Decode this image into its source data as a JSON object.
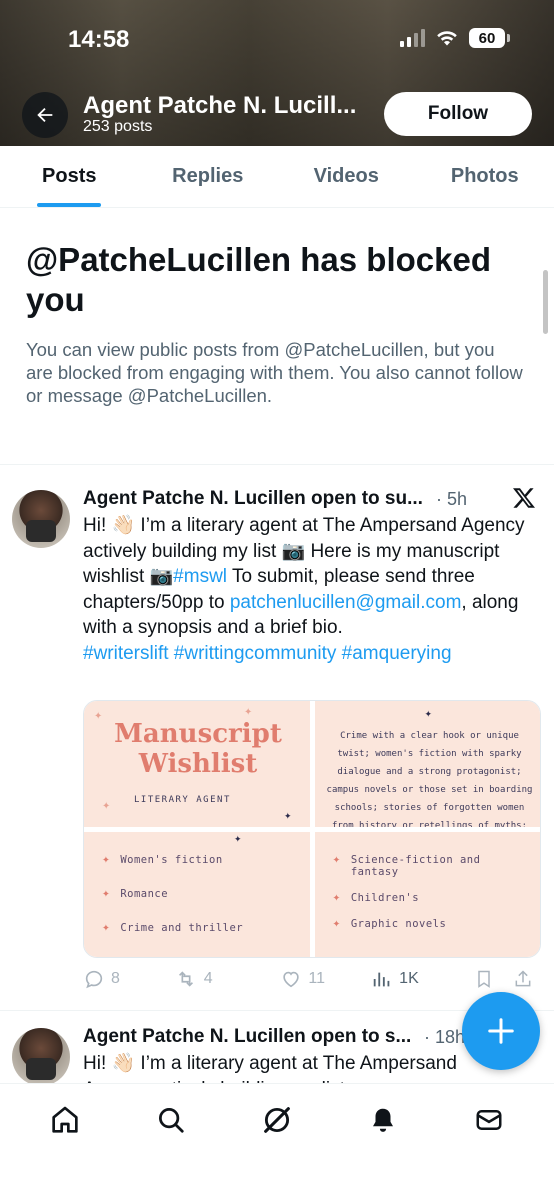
{
  "status_bar": {
    "time": "14:58",
    "battery": "60"
  },
  "header": {
    "title": "Agent Patche N. Lucill...",
    "posts_count": "253 posts",
    "follow_label": "Follow"
  },
  "tabs": [
    {
      "label": "Posts",
      "active": true
    },
    {
      "label": "Replies",
      "active": false
    },
    {
      "label": "Videos",
      "active": false
    },
    {
      "label": "Photos",
      "active": false
    }
  ],
  "blocked": {
    "title": "@PatcheLucillen has blocked you",
    "message": "You can view public posts from @PatcheLucillen, but you are blocked from engaging with them. You also cannot follow or message @PatcheLucillen."
  },
  "post1": {
    "author": "Agent Patche N. Lucillen open to su...",
    "time": "· 5h",
    "text_a": "Hi! 👋🏻 I’m a literary agent at The Ampersand Agency actively building my list 📷 Here is my manuscript wishlist 📷",
    "hashtag_mswl": "#mswl",
    "text_b": " To submit, please send three chapters/50pp to ",
    "email": "patchenlucillen@gmail.com",
    "text_c": ", along with a synopsis and a brief bio.",
    "hashtags": "#writerslift #writtingcommunity #amquerying",
    "media": {
      "title_line1": "Manuscript",
      "title_line2": "Wishlist",
      "subtitle": "LITERARY AGENT",
      "description": "Crime with a clear hook or unique twist; women's fiction with sparky dialogue and a strong protagonist; campus novels or those set in boarding schools; stories of forgotten women from history or retellings of myths:",
      "genres_left": [
        "Women's fiction",
        "Romance",
        "Crime and thriller"
      ],
      "genres_right": [
        "Science-fiction and fantasy",
        "Children's",
        "Graphic novels"
      ]
    },
    "stats": {
      "replies": "8",
      "reposts": "4",
      "likes": "11",
      "views": "1K"
    }
  },
  "post2": {
    "author": "Agent Patche N. Lucillen open to s...",
    "time": "· 18h",
    "text": "Hi! 👋🏻 I’m a literary agent at The Ampersand Agency actively building my list"
  },
  "icons": {
    "back": "arrow-left-icon",
    "x": "x-logo-icon",
    "compose": "plus-icon",
    "nav": [
      "home-icon",
      "search-icon",
      "grok-icon",
      "notifications-bell-icon",
      "messages-envelope-icon"
    ]
  },
  "colors": {
    "accent": "#1d9bf0",
    "text": "#0f1419",
    "muted": "#536471",
    "wishlist_title": "#e07d6e",
    "wishlist_bg": "#fbe6dc"
  }
}
